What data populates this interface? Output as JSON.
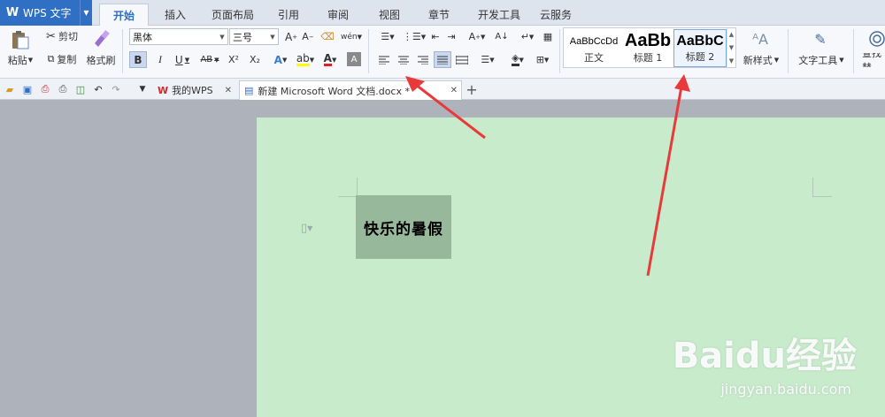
{
  "app": {
    "name": "WPS 文字",
    "logo": "W"
  },
  "menu_tabs": [
    {
      "label": "开始",
      "active": true
    },
    {
      "label": "插入"
    },
    {
      "label": "页面布局"
    },
    {
      "label": "引用"
    },
    {
      "label": "审阅"
    },
    {
      "label": "视图"
    },
    {
      "label": "章节"
    },
    {
      "label": "开发工具"
    },
    {
      "label": "云服务"
    }
  ],
  "clipboard": {
    "paste": "粘贴",
    "cut": "剪切",
    "copy": "复制",
    "format_painter": "格式刷"
  },
  "font": {
    "name": "黑体",
    "size": "三号"
  },
  "format_buttons": {
    "bold": "B",
    "italic": "I",
    "underline": "U",
    "strike": "AB",
    "superscript": "X²",
    "subscript": "X₂",
    "font_color": "A",
    "char_shading": "A"
  },
  "paragraph_align": {
    "active": "justify"
  },
  "styles": [
    {
      "preview": "AaBbCcDd",
      "name": "正文"
    },
    {
      "preview": "AaBb",
      "name": "标题 1"
    },
    {
      "preview": "AaBbC",
      "name": "标题 2",
      "selected": true
    }
  ],
  "new_style": "新样式",
  "text_tools": "文字工具",
  "find_replace": "查找替",
  "doc_tabs": [
    {
      "label": "我的WPS"
    },
    {
      "label": "新建 Microsoft Word 文档.docx *",
      "active": true
    }
  ],
  "document": {
    "heading": "快乐的暑假",
    "background_color": "#c7ebcb",
    "highlight_color": "#98b89b"
  },
  "watermark": {
    "brand": "Baidu经验",
    "url": "jingyan.baidu.com"
  },
  "colors": {
    "accent": "#2f6fc4",
    "arrow": "#e83a3a"
  }
}
